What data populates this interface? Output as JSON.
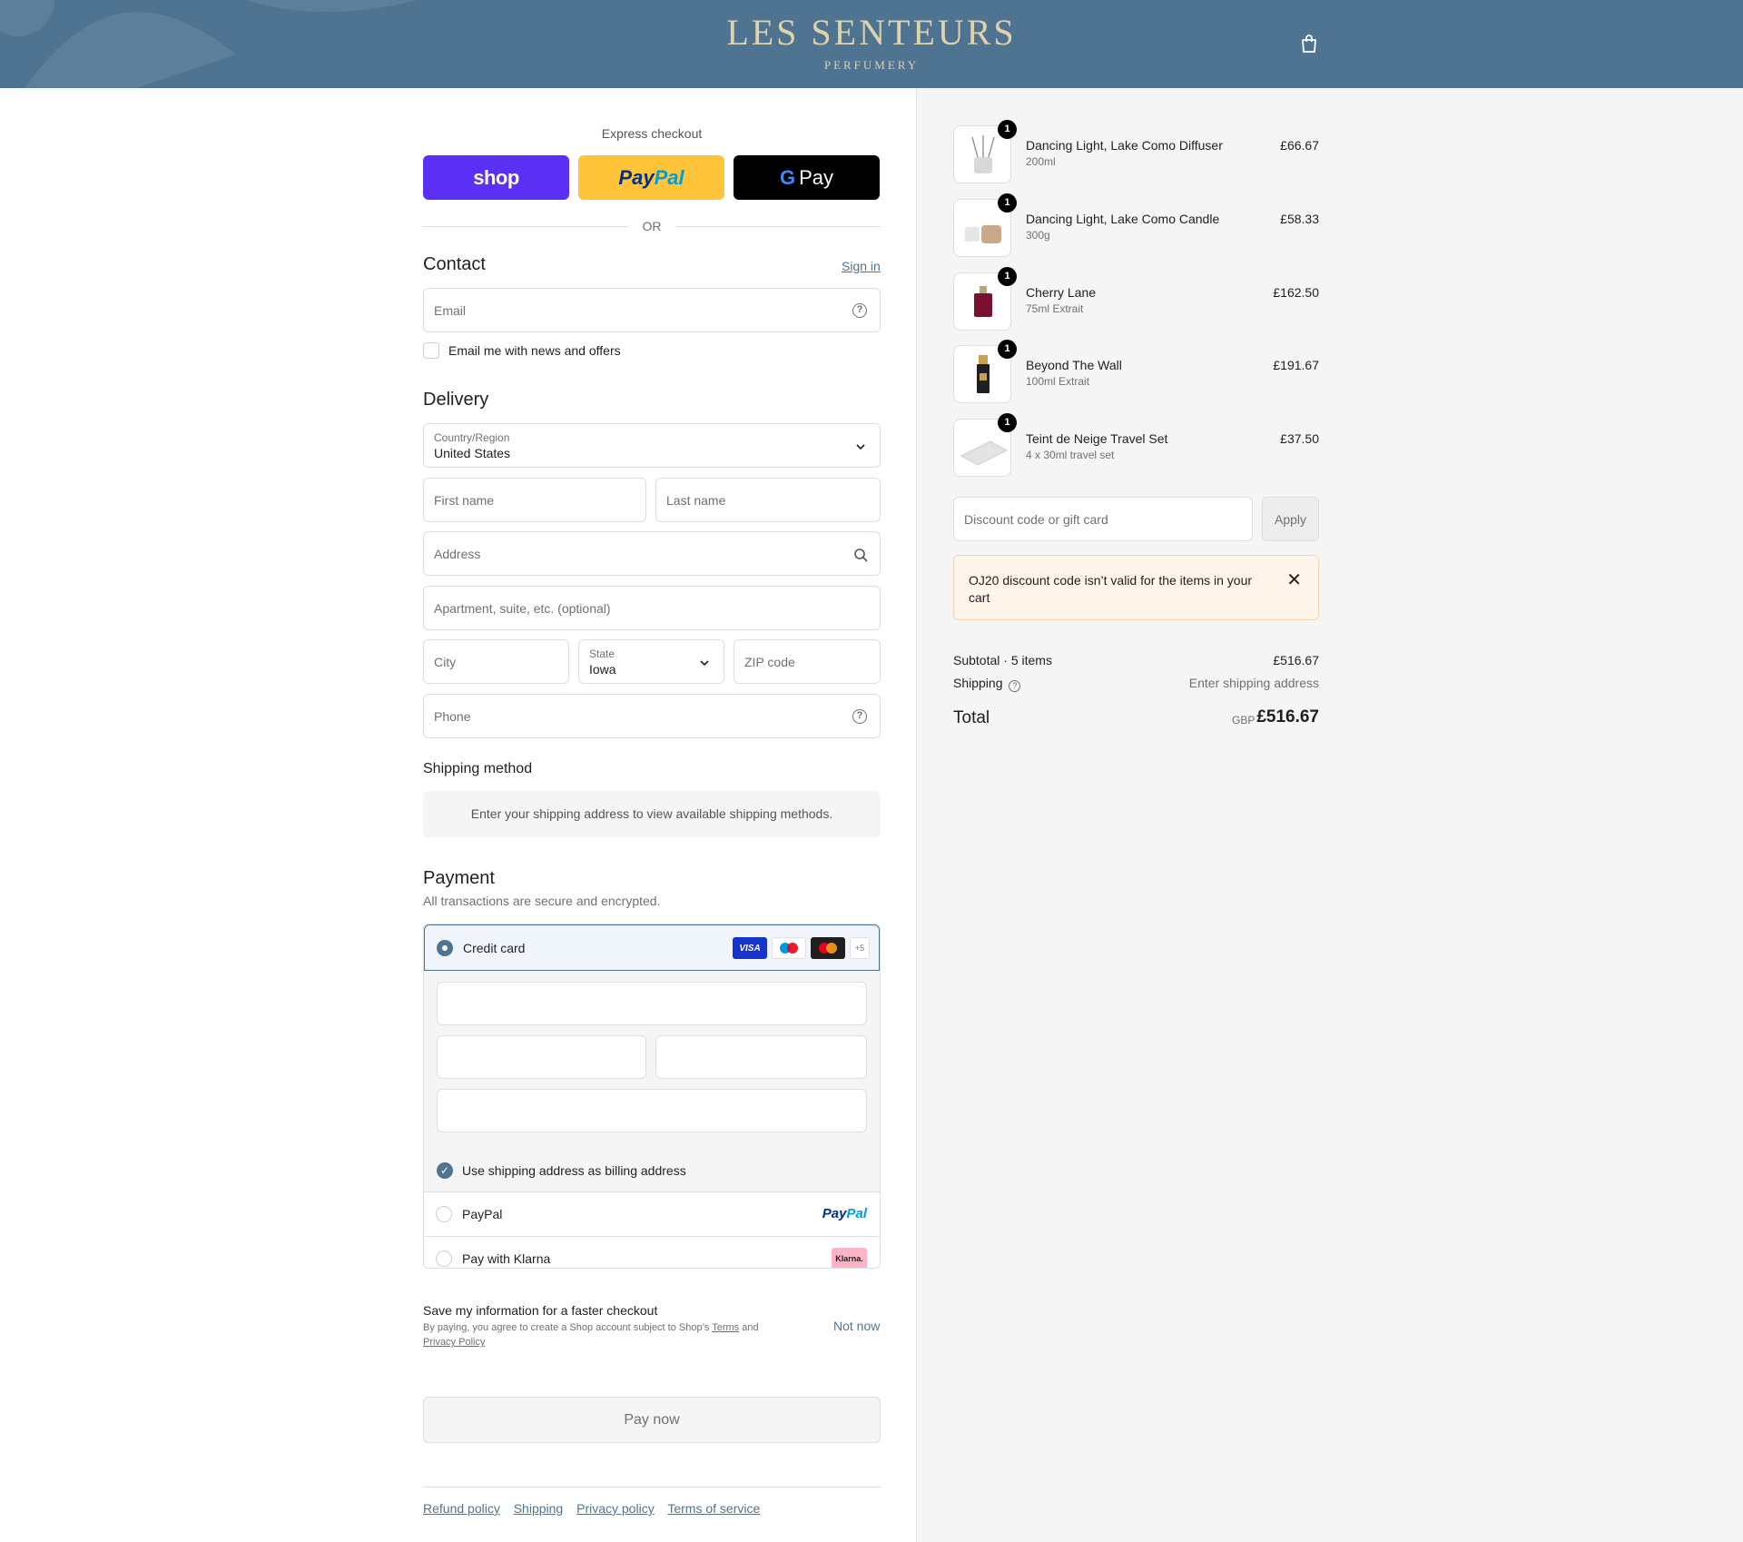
{
  "header": {
    "brand_name": "LES SENTEURS",
    "brand_sub": "PERFUMERY",
    "bg_color": "#4f7491",
    "cart_icon": "shopping-bag-icon"
  },
  "express": {
    "label": "Express checkout",
    "shop_label": "shop",
    "paypal_label_a": "Pay",
    "paypal_label_b": "Pal",
    "gpay_g": "G",
    "gpay_label": "Pay",
    "or_label": "OR"
  },
  "contact": {
    "title": "Contact",
    "sign_in": "Sign in",
    "email_placeholder": "Email",
    "news_label": "Email me with news and offers"
  },
  "delivery": {
    "title": "Delivery",
    "country_label": "Country/Region",
    "country_value": "United States",
    "first_name_placeholder": "First name",
    "last_name_placeholder": "Last name",
    "address_placeholder": "Address",
    "apartment_placeholder": "Apartment, suite, etc. (optional)",
    "city_placeholder": "City",
    "state_label": "State",
    "state_value": "Iowa",
    "zip_placeholder": "ZIP code",
    "phone_placeholder": "Phone"
  },
  "shipping_method": {
    "title": "Shipping method",
    "notice": "Enter your shipping address to view available shipping methods."
  },
  "payment": {
    "title": "Payment",
    "subtitle": "All transactions are secure and encrypted.",
    "credit_card_label": "Credit card",
    "card_logos": [
      "VISA",
      "Maestro",
      "Mastercard",
      "+5"
    ],
    "billing_label": "Use shipping address as billing address",
    "paypal_label": "PayPal",
    "paypal_logo_a": "Pay",
    "paypal_logo_b": "Pal",
    "klarna_label": "Pay with Klarna",
    "klarna_logo": "Klarna."
  },
  "save_info": {
    "title": "Save my information for a faster checkout",
    "fine_print_a": "By paying, you agree to create a Shop account subject to Shop’s ",
    "terms": "Terms",
    "fine_print_b": " and ",
    "privacy": "Privacy Policy",
    "not_now": "Not now"
  },
  "pay_now": "Pay now",
  "footer_links": [
    "Refund policy",
    "Shipping",
    "Privacy policy",
    "Terms of service"
  ],
  "cart": {
    "items": [
      {
        "name": "Dancing Light, Lake Como Diffuser",
        "variant": "200ml",
        "price": "£66.67",
        "qty": "1"
      },
      {
        "name": "Dancing Light, Lake Como Candle",
        "variant": "300g",
        "price": "£58.33",
        "qty": "1"
      },
      {
        "name": "Cherry Lane",
        "variant": "75ml Extrait",
        "price": "£162.50",
        "qty": "1"
      },
      {
        "name": "Beyond The Wall",
        "variant": "100ml Extrait",
        "price": "£191.67",
        "qty": "1"
      },
      {
        "name": "Teint de Neige Travel Set",
        "variant": "4 x 30ml travel set",
        "price": "£37.50",
        "qty": "1"
      }
    ],
    "discount_placeholder": "Discount code or gift card",
    "apply_label": "Apply",
    "alert_text": "OJ20 discount code isn’t valid for the items in your cart",
    "subtotal_label": "Subtotal · 5 items",
    "subtotal_value": "£516.67",
    "shipping_label": "Shipping",
    "shipping_value": "Enter shipping address",
    "total_label": "Total",
    "total_currency": "GBP",
    "total_value": "£516.67"
  }
}
